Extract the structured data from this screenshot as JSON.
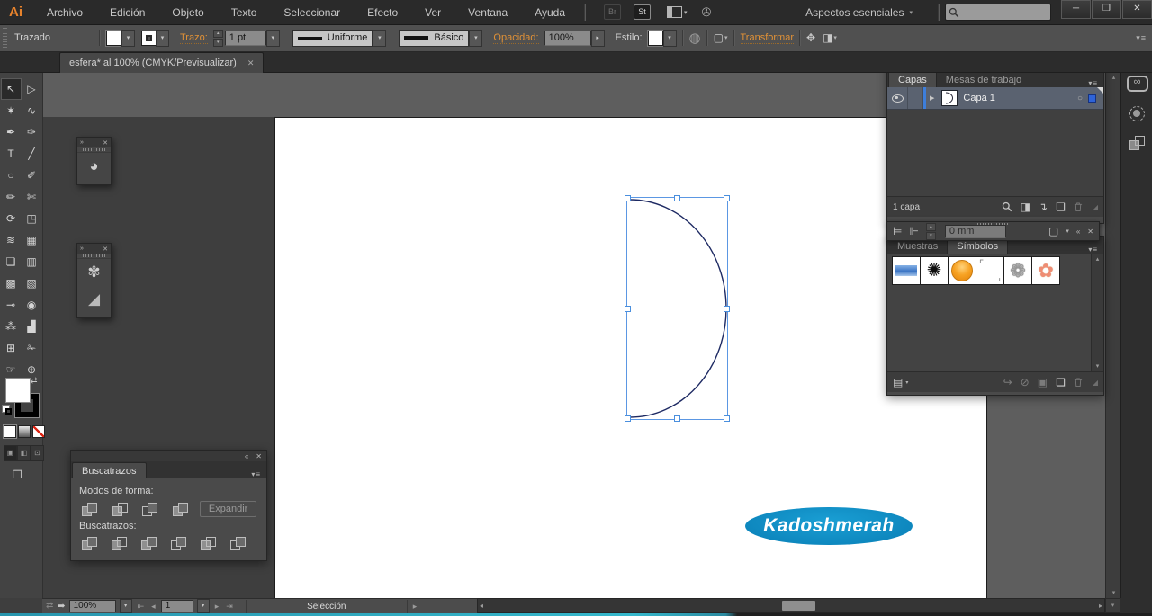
{
  "window": {
    "minimize": "─",
    "restore": "❐",
    "close": "✕"
  },
  "menubar": {
    "logo": "Ai",
    "items": [
      "Archivo",
      "Edición",
      "Objeto",
      "Texto",
      "Seleccionar",
      "Efecto",
      "Ver",
      "Ventana",
      "Ayuda"
    ],
    "bridge_label": "Br",
    "stock_label": "St",
    "workspace_label": "Aspectos esenciales"
  },
  "control_bar": {
    "selection_type": "Trazado",
    "stroke_label": "Trazo:",
    "stroke_weight": "1 pt",
    "variable_width_profile": "Uniforme",
    "brush_definition": "Básico",
    "opacity_label": "Opacidad:",
    "opacity_value": "100%",
    "style_label": "Estilo:",
    "transform_label": "Transformar"
  },
  "document_tab": {
    "title": "esfera* al 100% (CMYK/Previsualizar)"
  },
  "toolbar": {
    "tools": [
      {
        "name": "selection",
        "glyph": "↖"
      },
      {
        "name": "direct-selection",
        "glyph": "▷"
      },
      {
        "name": "magic-wand",
        "glyph": "✶"
      },
      {
        "name": "lasso",
        "glyph": "∿"
      },
      {
        "name": "pen",
        "glyph": "✒"
      },
      {
        "name": "curvature",
        "glyph": "✑"
      },
      {
        "name": "type",
        "glyph": "T"
      },
      {
        "name": "line-segment",
        "glyph": "╱"
      },
      {
        "name": "ellipse",
        "glyph": "○"
      },
      {
        "name": "paintbrush",
        "glyph": "✐"
      },
      {
        "name": "pencil",
        "glyph": "✏"
      },
      {
        "name": "scissors",
        "glyph": "✄"
      },
      {
        "name": "rotate",
        "glyph": "⟳"
      },
      {
        "name": "scale",
        "glyph": "◳"
      },
      {
        "name": "width",
        "glyph": "≋"
      },
      {
        "name": "free-transform",
        "glyph": "▦"
      },
      {
        "name": "shape-builder",
        "glyph": "❏"
      },
      {
        "name": "perspective-grid",
        "glyph": "▥"
      },
      {
        "name": "mesh",
        "glyph": "▩"
      },
      {
        "name": "gradient",
        "glyph": "▧"
      },
      {
        "name": "eyedropper",
        "glyph": "⊸"
      },
      {
        "name": "blend",
        "glyph": "◉"
      },
      {
        "name": "symbol-sprayer",
        "glyph": "⁂"
      },
      {
        "name": "column-graph",
        "glyph": "▟"
      },
      {
        "name": "artboard",
        "glyph": "⊞"
      },
      {
        "name": "slice",
        "glyph": "✁"
      },
      {
        "name": "hand",
        "glyph": "☞"
      },
      {
        "name": "zoom",
        "glyph": "⊕"
      }
    ]
  },
  "tearoff_panels": {
    "sphere_tool_glyph": "◕",
    "palette_tool_glyph": "✾",
    "wedge_tool_glyph": "◢"
  },
  "pathfinder_panel": {
    "tab": "Buscatrazos",
    "shape_modes_label": "Modos de forma:",
    "expand_label": "Expandir",
    "pathfinders_label": "Buscatrazos:"
  },
  "layers_panel": {
    "tabs": [
      "Capas",
      "Mesas de trabajo"
    ],
    "layer_name": "Capa 1",
    "count_label": "1 capa"
  },
  "align_bar": {
    "offset_value": "0 mm"
  },
  "symbols_panel": {
    "tabs": [
      "Muestras",
      "Símbolos"
    ]
  },
  "artboard": {
    "brand_text": "Kadoshmerah"
  },
  "status_bar": {
    "zoom_value": "100%",
    "artboard_number": "1",
    "current_tool": "Selección"
  },
  "icons": {
    "collapse": "«",
    "expand": "»",
    "close": "✕",
    "menu_arrow": "▾",
    "menu_lines": "≡",
    "arrow_up": "▴",
    "arrow_down": "▾",
    "arrow_left": "◂",
    "arrow_right": "▸",
    "nav_first": "⇤",
    "nav_last": "⇥",
    "swap": "⇄",
    "recolor": "◍",
    "dashed_box": "▢",
    "arrange": "✥",
    "align_pixel": "◨",
    "align_a": "⊨",
    "align_b": "⊩",
    "history": "⇄",
    "export": "➦",
    "screen_mode": "❐",
    "draw_normal": "▣",
    "draw_behind": "◧",
    "draw_inside": "⊡",
    "infinity": "∞",
    "clip_mask": "◨",
    "new_sublayer": "↴",
    "new_item": "❏",
    "place_symbol": "↪",
    "break_link": "⊘",
    "symbol_options": "▣",
    "libraries": "▤",
    "ink_splat": "✺",
    "twirl": "❁",
    "flower": "✿",
    "corner_tl": "⌜",
    "corner_br": "⌟",
    "target": "○",
    "layer_expand": "▶",
    "corner_grip": "◢"
  },
  "colors": {
    "accent_orange": "#e09137",
    "selection_blue": "#4a8fde",
    "brand_blue": "#0e8fc6",
    "pasteboard_gray": "#5e5e5e",
    "panel_gray": "#4a4a4a",
    "dark_gray": "#2b2b2b",
    "artboard_white": "#ffffff"
  }
}
